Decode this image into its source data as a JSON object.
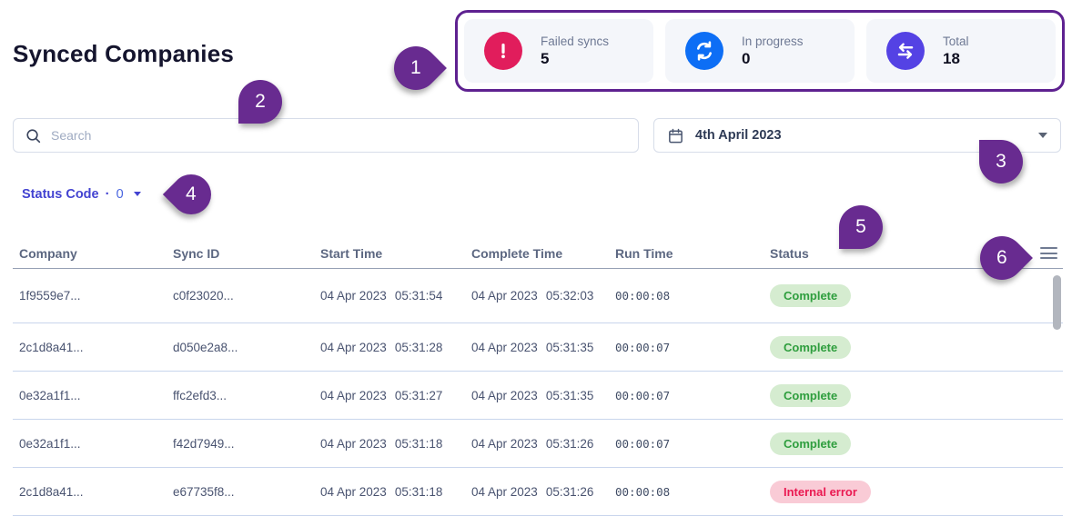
{
  "page": {
    "title": "Synced Companies"
  },
  "stats": {
    "cards": [
      {
        "label": "Failed syncs",
        "value": "5",
        "icon": "alert-icon",
        "color": "#e11d5c"
      },
      {
        "label": "In progress",
        "value": "0",
        "icon": "refresh-icon",
        "color": "#0d6ef5"
      },
      {
        "label": "Total",
        "value": "18",
        "icon": "transfer-icon",
        "color": "#5442e4"
      }
    ]
  },
  "search": {
    "placeholder": "Search"
  },
  "date_picker": {
    "value": "4th April 2023"
  },
  "status_filter": {
    "label": "Status Code",
    "separator": "·",
    "count": "0"
  },
  "table": {
    "columns": [
      "Company",
      "Sync ID",
      "Start Time",
      "Complete Time",
      "Run Time",
      "Status"
    ],
    "rows": [
      {
        "company": "1f9559e7...",
        "sync_id": "c0f23020...",
        "start_date": "04 Apr 2023",
        "start_time": "05:31:54",
        "complete_date": "04 Apr 2023",
        "complete_time": "05:32:03",
        "run_time": "00:00:08",
        "status": "Complete",
        "status_type": "success"
      },
      {
        "company": "2c1d8a41...",
        "sync_id": "d050e2a8...",
        "start_date": "04 Apr 2023",
        "start_time": "05:31:28",
        "complete_date": "04 Apr 2023",
        "complete_time": "05:31:35",
        "run_time": "00:00:07",
        "status": "Complete",
        "status_type": "success"
      },
      {
        "company": "0e32a1f1...",
        "sync_id": "ffc2efd3...",
        "start_date": "04 Apr 2023",
        "start_time": "05:31:27",
        "complete_date": "04 Apr 2023",
        "complete_time": "05:31:35",
        "run_time": "00:00:07",
        "status": "Complete",
        "status_type": "success"
      },
      {
        "company": "0e32a1f1...",
        "sync_id": "f42d7949...",
        "start_date": "04 Apr 2023",
        "start_time": "05:31:18",
        "complete_date": "04 Apr 2023",
        "complete_time": "05:31:26",
        "run_time": "00:00:07",
        "status": "Complete",
        "status_type": "success"
      },
      {
        "company": "2c1d8a41...",
        "sync_id": "e67735f8...",
        "start_date": "04 Apr 2023",
        "start_time": "05:31:18",
        "complete_date": "04 Apr 2023",
        "complete_time": "05:31:26",
        "run_time": "00:00:08",
        "status": "Internal error",
        "status_type": "error"
      }
    ]
  },
  "annotations": [
    "1",
    "2",
    "3",
    "4",
    "5",
    "6"
  ],
  "colors": {
    "annotation_purple": "#682b90",
    "success_bg": "#d5ecd0",
    "success_text": "#2f9e3e",
    "error_bg": "#f9cbd6",
    "error_text": "#ea1951"
  }
}
